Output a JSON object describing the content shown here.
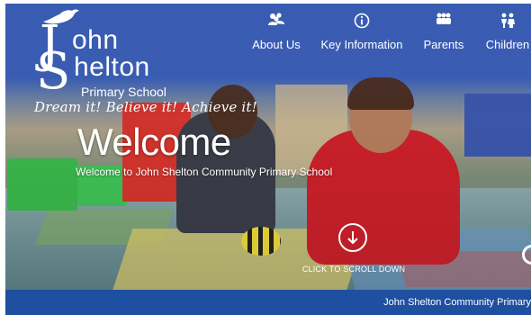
{
  "logo": {
    "name_line1": "ohn",
    "name_line2": "helton",
    "initial_j": "J",
    "initial_s": "S",
    "subtitle": "Primary School"
  },
  "tagline": "Dream it! Believe it! Achieve it!",
  "nav": {
    "items": [
      {
        "label": "About Us",
        "icon": "users-icon"
      },
      {
        "label": "Key Information",
        "icon": "info-icon"
      },
      {
        "label": "Parents",
        "icon": "parents-icon"
      },
      {
        "label": "Children",
        "icon": "children-icon"
      }
    ]
  },
  "hero": {
    "title": "Welcome",
    "subtitle": "Welcome to John Shelton Community Primary School",
    "scroll_label": "CLICK TO SCROLL DOWN"
  },
  "footer": {
    "text": "John Shelton Community Primary"
  },
  "colors": {
    "header_blue": "#3b5fb4",
    "footer_blue": "#1f4fa0",
    "text": "#ffffff"
  }
}
